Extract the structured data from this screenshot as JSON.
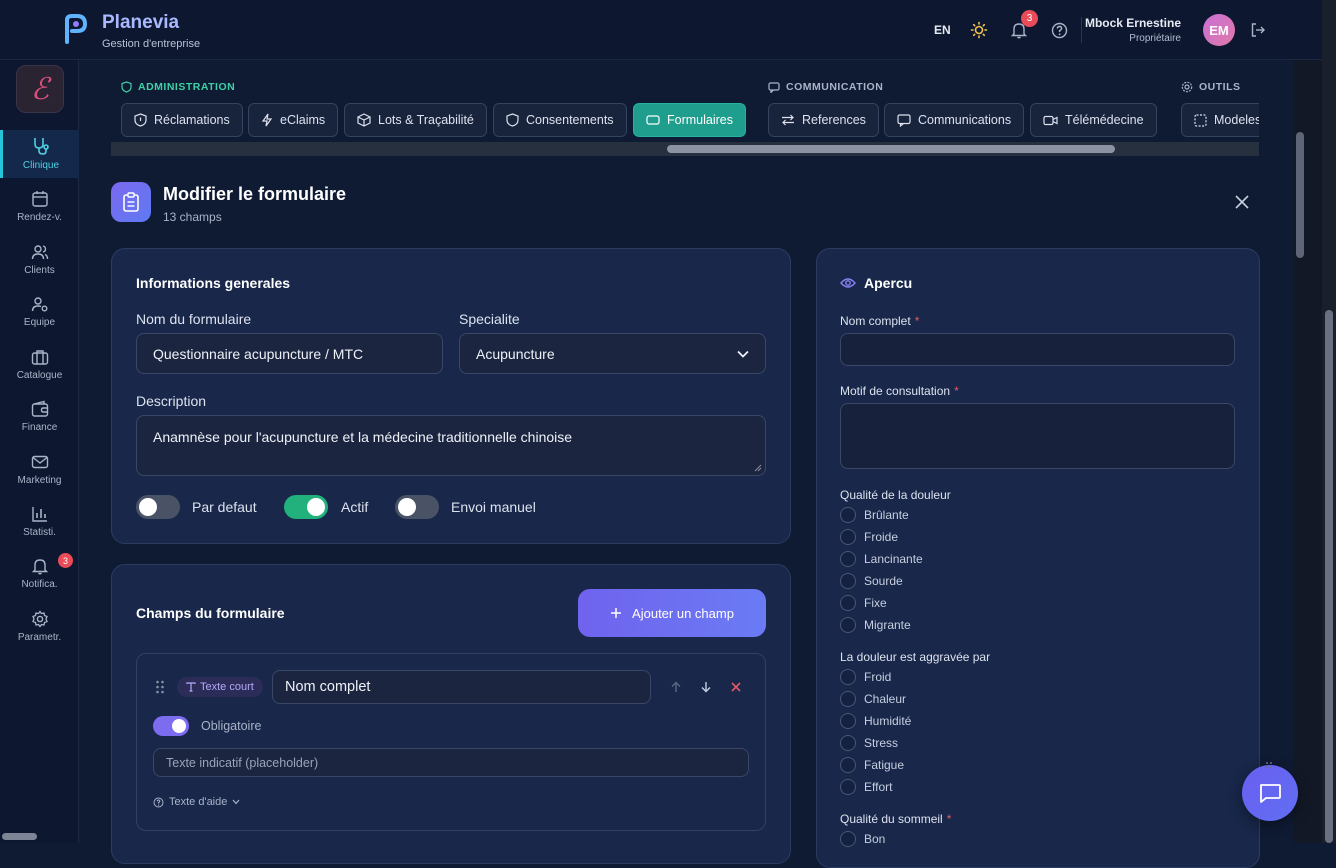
{
  "header": {
    "brand": "Planevia",
    "brand_sub": "Gestion d'entreprise",
    "lang": "EN",
    "notif_count": "3",
    "user_name": "Mbock Ernestine",
    "user_role": "Propriétaire",
    "avatar_initials": "EM"
  },
  "sidebar": {
    "logo_letter": "ℰ",
    "items": [
      {
        "label": "Clinique",
        "icon": "stethoscope-icon"
      },
      {
        "label": "Rendez-v.",
        "icon": "calendar-icon"
      },
      {
        "label": "Clients",
        "icon": "users-icon"
      },
      {
        "label": "Equipe",
        "icon": "user-gear-icon"
      },
      {
        "label": "Catalogue",
        "icon": "briefcase-icon"
      },
      {
        "label": "Finance",
        "icon": "wallet-icon"
      },
      {
        "label": "Marketing",
        "icon": "mail-icon"
      },
      {
        "label": "Statisti.",
        "icon": "chart-icon"
      },
      {
        "label": "Notifica.",
        "icon": "bell-icon"
      },
      {
        "label": "Parametr.",
        "icon": "gear-icon"
      }
    ],
    "notif_badge": "3"
  },
  "groups": {
    "admin_label": "ADMINISTRATION",
    "comm_label": "COMMUNICATION",
    "tools_label": "OUTILS",
    "tabs": [
      "Réclamations",
      "eClaims",
      "Lots & Traçabilité",
      "Consentements",
      "Formulaires",
      "References",
      "Communications",
      "Télémédecine",
      "Modeles"
    ]
  },
  "form": {
    "title": "Modifier le formulaire",
    "subtitle": "13 champs",
    "general_title": "Informations generales",
    "name_label": "Nom du formulaire",
    "name_value": "Questionnaire acupuncture / MTC",
    "specialty_label": "Specialite",
    "specialty_value": "Acupuncture",
    "desc_label": "Description",
    "desc_value": "Anamnèse pour l'acupuncture et la médecine traditionnelle chinoise",
    "toggle_default": "Par defaut",
    "toggle_active": "Actif",
    "toggle_manual": "Envoi manuel",
    "fields_title": "Champs du formulaire",
    "add_field": "Ajouter un champ",
    "field1": {
      "type": "Texte court",
      "name": "Nom complet",
      "required": "Obligatoire",
      "placeholder_hint": "Texte indicatif (placeholder)",
      "help": "Texte d'aide"
    }
  },
  "preview": {
    "title": "Apercu",
    "q1": "Nom complet",
    "q2": "Motif de consultation",
    "q3": "Qualité de la douleur",
    "q3_options": [
      "Brûlante",
      "Froide",
      "Lancinante",
      "Sourde",
      "Fixe",
      "Migrante"
    ],
    "q4": "La douleur est aggravée par",
    "q4_options": [
      "Froid",
      "Chaleur",
      "Humidité",
      "Stress",
      "Fatigue",
      "Effort"
    ],
    "q5": "Qualité du sommeil",
    "q5_options": [
      "Bon"
    ],
    "required_mark": "*"
  },
  "colors": {
    "accent": "#6a6ff2",
    "active_tab": "#1f9e8e",
    "toggle_on": "#22b07d",
    "required": "#e35a66"
  }
}
